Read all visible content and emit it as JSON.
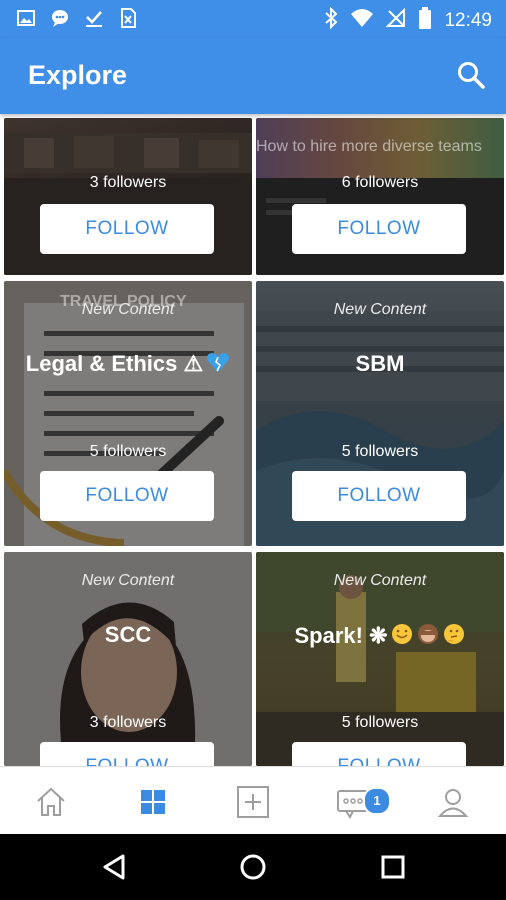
{
  "status_bar": {
    "time": "12:49",
    "left_icons": [
      "image-icon",
      "chat-icon",
      "download-icon",
      "file-icon"
    ],
    "right_icons": [
      "bluetooth-icon",
      "wifi-icon",
      "no-signal-icon",
      "battery-icon"
    ]
  },
  "app_bar": {
    "title": "Explore",
    "search_icon": "search-icon"
  },
  "colors": {
    "primary": "#3f8ee8",
    "accent": "#3c8be3",
    "nav_inactive": "#9e9e9e"
  },
  "cards": [
    {
      "name": "",
      "tag": "",
      "followers": "3 followers",
      "follow_label": "FOLLOW"
    },
    {
      "name": "",
      "tag": "",
      "background_text": "How to hire more diverse teams",
      "followers": "6 followers",
      "follow_label": "FOLLOW"
    },
    {
      "name": "Legal & Ethics ⚠",
      "tag": "New Content",
      "background_text": "TRAVEL POLICY",
      "followers": "5 followers",
      "follow_label": "FOLLOW"
    },
    {
      "name": "SBM",
      "tag": "New Content",
      "followers": "5 followers",
      "follow_label": "FOLLOW"
    },
    {
      "name": "SCC",
      "tag": "New Content",
      "followers": "3 followers",
      "follow_label": "FOLLOW"
    },
    {
      "name": "Spark! ❋",
      "tag": "New Content",
      "followers": "5 followers",
      "follow_label": "FOLLOW"
    }
  ],
  "bottom_nav": {
    "items": [
      "home-icon",
      "grid-icon",
      "add-icon",
      "chat-icon",
      "profile-icon"
    ],
    "active": "grid-icon",
    "chat_badge": "1"
  },
  "system_nav": [
    "back-icon",
    "home-circle-icon",
    "recents-icon"
  ]
}
